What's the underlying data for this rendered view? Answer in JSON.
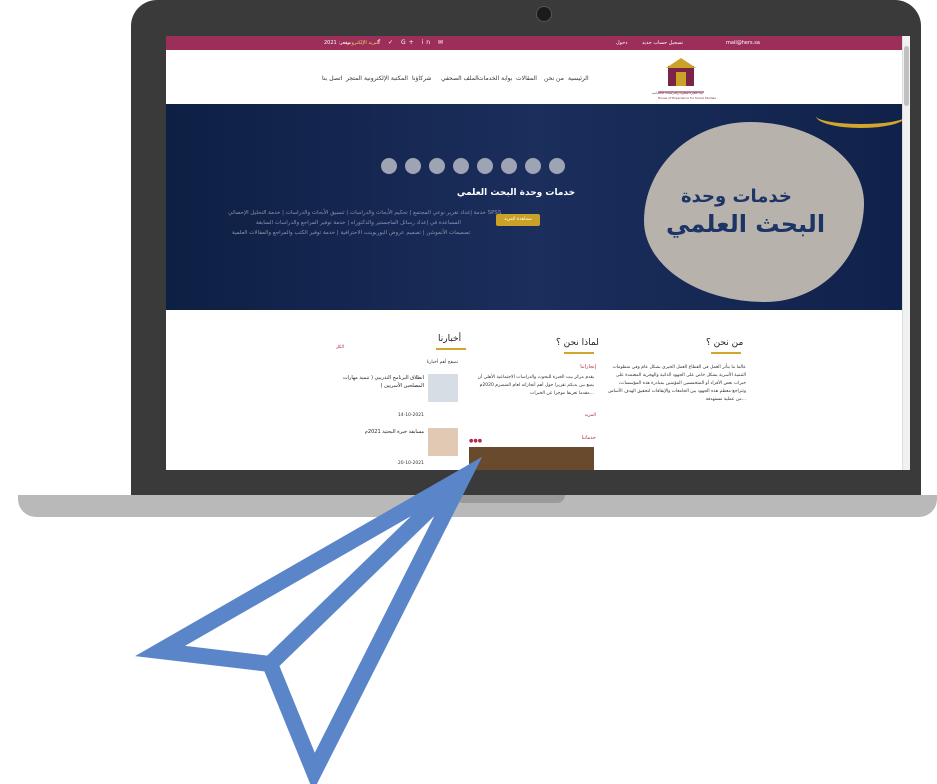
{
  "topbar": {
    "email": "mail@hers.sa",
    "register": "تسجيل حساب جديد",
    "login": "دخول",
    "mail_label": "البريد الإلكتروني",
    "prayer": "مقعر: 2021"
  },
  "nav": {
    "items": [
      "الرئيسية",
      "من نحن",
      "المقالات",
      "بوابة الخدمات",
      "الملف الصحفي",
      "شركاؤنا",
      "المكتبة الإلكترونية",
      "المتجر",
      "اتصل بنا"
    ]
  },
  "logo": {
    "caption": "بيت الخبرة للبحوث والدراسات الاجتماعية",
    "caption_en": "House of Experience for Social Studies"
  },
  "hero": {
    "title": "خدمات وحدة البحث العلمي",
    "button": "مشاهدة المزيد",
    "blob_line1": "خدمات وحدة",
    "blob_line2": "البحث العلمي",
    "lines": [
      "خدمة إعداد تقرير نوعي المجتمع | تحكيم الأبحاث والدراسات | تنسيق الأبحاث والدراسات | خدمة التحليل الإحصائي SPSS",
      "المساعدة في إعداد رسائل الماجستير والدكتوراه | خدمة توفير المراجع والدراسات السابقة",
      "تصميمات الأنموشن | تصميم عروض البوربوينت الاحترافية | خدمة توفير الكتب والمراجع والمقالات العلمية"
    ]
  },
  "about": {
    "title": "من نحن ؟",
    "body": "عالما ما يتأثر العمل في القطاع العمل الخيري بشكل عام وفي منظومات التنمية الأسرية بشكل خاص على الجهود الذاتية والهجرية المعتمدة على خبرات بعض الأفراد أو المتحمسين المؤمنين بمبادرة هذه المؤسسات، وتتراجع معظم هذه الجهود بين الجامعات والإيقافات لتحقيق الهدف الأساس من عملية مستهدفة..."
  },
  "why": {
    "title": "لماذا نحن ؟",
    "sub1": "إنجازاتنا",
    "body": "يقدم مركز بيت الخبرة للبحوث والدراسات الاجتماعية الأهلي أن يضع بين يديكم تقريرا حول أهم أنجازاته لعام المنصرم 2020م مقدما تعريفا موجزا عن الخبرات...",
    "more": "المزيد",
    "sub2": "خدماتنا"
  },
  "news": {
    "title": "أخبارنا",
    "all": "الكل",
    "item0": "تصفح أهم أخبارنا",
    "item1_title": "انطلاق البرنامج التدريبي ( تنمية مهارات المصلحين الأسريين )",
    "item1_date": "14-10-2021",
    "item2_title": "مسابقة خبرة البحثية 2021م",
    "item2_date": "20-10-2021"
  },
  "icons": [
    "envelope-icon",
    "facebook-icon",
    "twitter-icon",
    "google-plus-icon",
    "linkedin-icon",
    "instagram-icon",
    "cart-icon",
    "send-icon"
  ]
}
